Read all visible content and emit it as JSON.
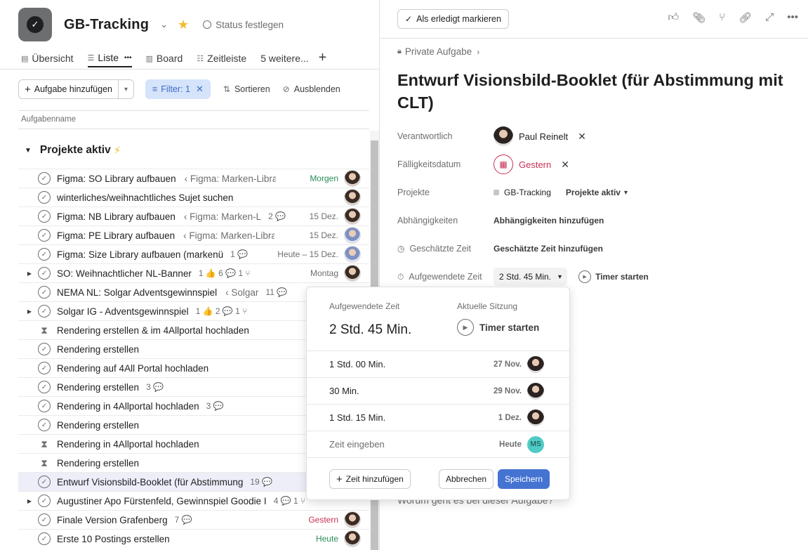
{
  "project": {
    "title": "GB-Tracking",
    "status_label": "Status festlegen"
  },
  "tabs": [
    {
      "label": "Übersicht",
      "icon": "clipboard-icon"
    },
    {
      "label": "Liste",
      "icon": "list-icon",
      "extra": "•••"
    },
    {
      "label": "Board",
      "icon": "board-icon"
    },
    {
      "label": "Zeitleiste",
      "icon": "timeline-icon"
    },
    {
      "label": "5 weitere..."
    }
  ],
  "toolbar": {
    "add_task": "Aufgabe hinzufügen",
    "filter": "Filter: 1",
    "sort": "Sortieren",
    "hide": "Ausblenden"
  },
  "list": {
    "column_header": "Aufgabenname",
    "section": "Projekte aktiv"
  },
  "tasks": [
    {
      "name": "Figma: SO Library aufbauen",
      "parent": "‹ Figma: Marken-Librai",
      "meta": "",
      "due": "Morgen",
      "due_color": "green",
      "avatar": "female"
    },
    {
      "name": "winterliches/weihnachtliches Sujet suchen",
      "parent": "",
      "meta": "",
      "due": "",
      "avatar": "female"
    },
    {
      "name": "Figma: NB Library aufbauen",
      "parent": "‹ Figma: Marken-L",
      "meta": "2 💬",
      "due": "15 Dez.",
      "avatar": "female"
    },
    {
      "name": "Figma: PE Library aufbauen",
      "parent": "‹ Figma: Marken-Librai",
      "meta": "",
      "due": "15 Dez.",
      "avatar": "blue"
    },
    {
      "name": "Figma: Size Library aufbauen (markenü",
      "parent": "",
      "meta": "1 💬",
      "due": "Heute – 15 Dez.",
      "avatar": "blue"
    },
    {
      "name": "SO: Weihnachtlicher NL-Banner",
      "parent": "",
      "meta": "1 👍  6 💬  1 ⑂",
      "due": "Montag",
      "avatar": "female",
      "expand": true
    },
    {
      "name": "NEMA NL: Solgar Adventsgewinnspiel",
      "parent": "‹ Solgar",
      "meta": "11 💬",
      "due": "",
      "avatar": ""
    },
    {
      "name": "Solgar IG - Adventsgewinnspiel",
      "parent": "",
      "meta": "1 👍  2 💬  1 ⑂",
      "due": "",
      "avatar": "",
      "expand": true
    },
    {
      "name": "Rendering erstellen & im 4Allportal hochladen",
      "parent": "",
      "meta": "",
      "due": "",
      "avatar": "",
      "hourglass": true
    },
    {
      "name": "Rendering erstellen",
      "parent": "",
      "meta": "",
      "due": "",
      "avatar": ""
    },
    {
      "name": "Rendering auf 4All Portal hochladen",
      "parent": "",
      "meta": "",
      "due": "",
      "avatar": ""
    },
    {
      "name": "Rendering erstellen",
      "parent": "",
      "meta": "3 💬",
      "due": "",
      "avatar": ""
    },
    {
      "name": "Rendering in 4Allportal hochladen",
      "parent": "",
      "meta": "3 💬",
      "due": "",
      "avatar": ""
    },
    {
      "name": "Rendering erstellen",
      "parent": "",
      "meta": "",
      "due": "",
      "avatar": ""
    },
    {
      "name": "Rendering in 4Allportal hochladen",
      "parent": "",
      "meta": "",
      "due": "",
      "avatar": "",
      "hourglass": true
    },
    {
      "name": "Rendering erstellen",
      "parent": "",
      "meta": "",
      "due": "",
      "avatar": "",
      "hourglass": true
    },
    {
      "name": "Entwurf Visionsbild-Booklet (für Abstimmung",
      "parent": "",
      "meta": "19 💬",
      "due": "",
      "avatar": "",
      "selected": true
    },
    {
      "name": "Augustiner Apo Fürstenfeld, Gewinnspiel Goodie I",
      "parent": "",
      "meta": "4 💬  1 ⑂",
      "due": "",
      "avatar": "",
      "expand": true
    },
    {
      "name": "Finale Version Grafenberg",
      "parent": "",
      "meta": "7 💬",
      "due": "Gestern",
      "due_color": "red",
      "avatar": "female"
    },
    {
      "name": "Erste 10 Postings erstellen",
      "parent": "",
      "meta": "",
      "due": "Heute",
      "due_color": "green",
      "avatar": "female"
    }
  ],
  "detail": {
    "mark_done": "Als erledigt markieren",
    "breadcrumb": "Private Aufgabe",
    "title": "Entwurf Visionsbild-Booklet (für Abstimmung mit CLT)",
    "fields": {
      "assignee_label": "Verantwortlich",
      "assignee": "Paul Reinelt",
      "due_label": "Fälligkeitsdatum",
      "due": "Gestern",
      "projects_label": "Projekte",
      "project": "GB-Tracking",
      "project_section": "Projekte aktiv",
      "deps_label": "Abhängigkeiten",
      "deps_action": "Abhängigkeiten hinzufügen",
      "estimate_label": "Geschätzte Zeit",
      "estimate_action": "Geschätzte Zeit hinzufügen",
      "spent_label": "Aufgewendete Zeit",
      "spent": "2 Std. 45 Min.",
      "timer": "Timer starten"
    },
    "description_placeholder": "Worum geht es bei dieser Aufgabe?"
  },
  "popover": {
    "spent_label": "Aufgewendete Zeit",
    "session_label": "Aktuelle Sitzung",
    "total": "2 Std. 45 Min.",
    "timer": "Timer starten",
    "entries": [
      {
        "duration": "1 Std. 00 Min.",
        "date": "27 Nov."
      },
      {
        "duration": "30 Min.",
        "date": "29 Nov."
      },
      {
        "duration": "1 Std. 15 Min.",
        "date": "1 Dez."
      }
    ],
    "input_placeholder": "Zeit eingeben",
    "input_date": "Heute",
    "input_avatar": "MS",
    "add_time": "Zeit hinzufügen",
    "cancel": "Abbrechen",
    "save": "Speichern"
  },
  "colors": {
    "accent": "#4573d2",
    "filter_bg": "#d5e3fb",
    "overdue": "#c92f54",
    "upcoming": "#2b8c58",
    "star": "#f1bd2b"
  }
}
